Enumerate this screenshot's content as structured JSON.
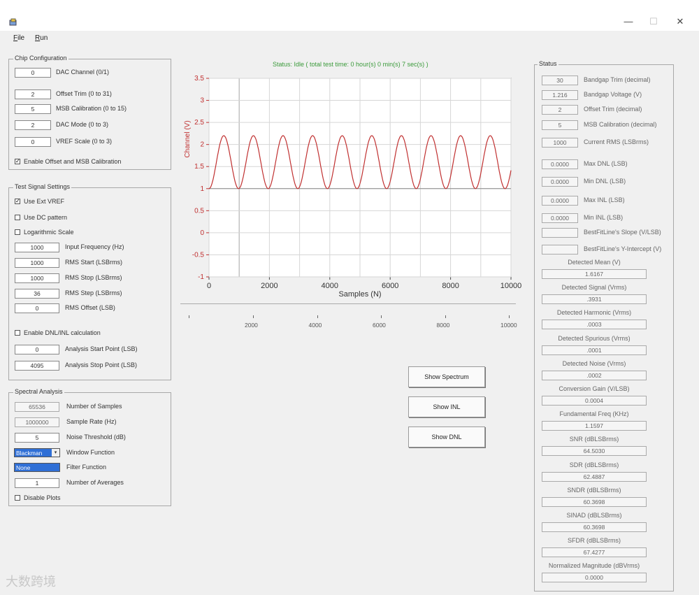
{
  "window": {
    "minimize_glyph": "—",
    "maximize_glyph": "☐",
    "close_glyph": "✕"
  },
  "menu": [
    {
      "label": "File",
      "underline": "F",
      "rest": "ile"
    },
    {
      "label": "Run",
      "underline": "R",
      "rest": "un"
    }
  ],
  "chip_config": {
    "title": "Chip Configuration",
    "fields": [
      {
        "value": "0",
        "label": "DAC Channel (0/1)"
      },
      {
        "value": "2",
        "label": "Offset Trim (0 to 31)"
      },
      {
        "value": "5",
        "label": "MSB Calibration (0 to 15)"
      },
      {
        "value": "2",
        "label": "DAC Mode (0 to 3)"
      },
      {
        "value": "0",
        "label": "VREF Scale (0 to 3)"
      }
    ],
    "enable_cal": {
      "label": "Enable Offset and MSB Calibration",
      "checked": true
    }
  },
  "test_signal": {
    "title": "Test Signal Settings",
    "use_ext_vref": {
      "label": "Use Ext VREF",
      "checked": true
    },
    "use_dc": {
      "label": "Use DC pattern",
      "checked": false
    },
    "log_scale": {
      "label": "Logarithmic  Scale",
      "checked": false
    },
    "fields": [
      {
        "value": "1000",
        "label": "Input Frequency (Hz)"
      },
      {
        "value": "1000",
        "label": "RMS Start (LSBrms)"
      },
      {
        "value": "1000",
        "label": "RMS Stop (LSBrms)"
      },
      {
        "value": "36",
        "label": "RMS Step (LSBrms)"
      },
      {
        "value": "0",
        "label": "RMS Offset (LSB)"
      }
    ],
    "enable_dnl": {
      "label": "Enable DNL/INL calculation",
      "checked": false
    },
    "analysis": [
      {
        "value": "0",
        "label": "Analysis Start Point (LSB)"
      },
      {
        "value": "4095",
        "label": "Analysis Stop Point (LSB)"
      }
    ]
  },
  "spectral": {
    "title": "Spectral Analysis",
    "samples": {
      "value": "65536",
      "label": "Number of Samples"
    },
    "rate": {
      "value": "1000000",
      "label": "Sample Rate (Hz)"
    },
    "noise": {
      "value": "5",
      "label": "Noise Threshold (dB)"
    },
    "window": {
      "value": "Blackman",
      "label": "Window Function"
    },
    "filter": {
      "value": "None",
      "label": "Filter Function"
    },
    "averages": {
      "value": "1",
      "label": "Number of Averages"
    },
    "disable_plots": {
      "label": "Disable Plots",
      "checked": false
    }
  },
  "status_line": "Status: Idle ( total test time: 0 hour(s) 0 min(s) 7 sec(s) )",
  "chart_data": {
    "type": "line",
    "xlabel": "Samples (N)",
    "ylabel": "Channel (V)",
    "xlim": [
      0,
      10000
    ],
    "ylim": [
      -1,
      3.5
    ],
    "xticks": [
      "0",
      "2000",
      "4000",
      "6000",
      "8000",
      "10000"
    ],
    "yticks": [
      "3.5",
      "3",
      "2.5",
      "2",
      "1.5",
      "1",
      "0.5",
      "0",
      "-0.5",
      "-1"
    ],
    "series": [
      {
        "amplitude": 0.6,
        "offset": 1.6,
        "cycles": 10.2,
        "color": "#c03030"
      }
    ],
    "grid": true
  },
  "scroll_ticks": [
    "2000",
    "4000",
    "6000",
    "8000",
    "10000"
  ],
  "buttons": {
    "spectrum": "Show Spectrum",
    "inl": "Show INL",
    "dnl": "Show DNL"
  },
  "status_panel": {
    "title": "Status",
    "rows": [
      {
        "value": "30",
        "label": "Bandgap Trim (decimal)"
      },
      {
        "value": "1.216",
        "label": "Bandgap Voltage (V)"
      },
      {
        "value": "2",
        "label": "Offset Trim (decimal)"
      },
      {
        "value": "5",
        "label": "MSB Calibration (decimal)"
      },
      {
        "value": "1000",
        "label": "Current RMS (LSBrms)"
      },
      {
        "value": "0.0000",
        "label": "Max DNL (LSB)"
      },
      {
        "value": "0.0000",
        "label": "Min DNL (LSB)"
      },
      {
        "value": "0.0000",
        "label": "Max INL (LSB)"
      },
      {
        "value": "0.0000",
        "label": "Min INL (LSB)"
      },
      {
        "value": "",
        "label": "BestFitLine's Slope (V/LSB)"
      },
      {
        "value": "",
        "label": "BestFitLine's Y-Intercept (V)"
      }
    ],
    "metrics": [
      {
        "label": "Detected Mean (V)",
        "value": "1.6167"
      },
      {
        "label": "Detected Signal (Vrms)",
        "value": ".3931"
      },
      {
        "label": "Detected Harmonic (Vrms)",
        "value": ".0003"
      },
      {
        "label": "Detected Spurious (Vrms)",
        "value": ".0001"
      },
      {
        "label": "Detected Noise (Vrms)",
        "value": ".0002"
      },
      {
        "label": "Conversion Gain (V/LSB)",
        "value": "0.0004"
      },
      {
        "label": "Fundamental Freq (KHz)",
        "value": "1.1597"
      },
      {
        "label": "SNR (dBLSBrms)",
        "value": "64.5030"
      },
      {
        "label": "SDR (dBLSBrms)",
        "value": "62.4887"
      },
      {
        "label": "SNDR (dBLSBrms)",
        "value": "60.3698"
      },
      {
        "label": "SINAD (dBLSBrms)",
        "value": "60.3698"
      },
      {
        "label": "SFDR  (dBLSBrms)",
        "value": "67.4277"
      },
      {
        "label": "Normalized Magnitude (dBVrms)",
        "value": "0.0000"
      }
    ]
  },
  "watermark": "大数跨境"
}
